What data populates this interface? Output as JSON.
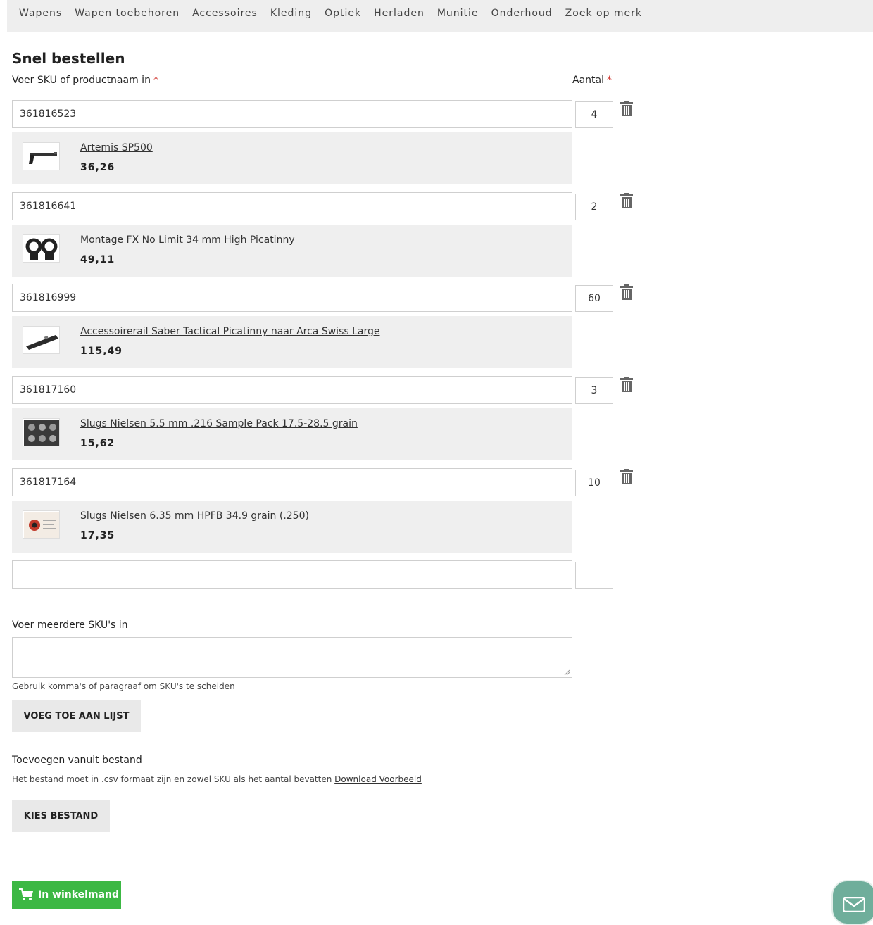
{
  "nav": {
    "items": [
      "Wapens",
      "Wapen toebehoren",
      "Accessoires",
      "Kleding",
      "Optiek",
      "Herladen",
      "Munitie",
      "Onderhoud",
      "Zoek op merk"
    ]
  },
  "page": {
    "title": "Snel bestellen"
  },
  "labels": {
    "sku": "Voer SKU of productnaam in",
    "qty": "Aantal",
    "required_mark": "*"
  },
  "rows": [
    {
      "sku": "361816523",
      "qty": "4",
      "product": {
        "name": "Artemis SP500",
        "price": "36,26",
        "thumb_icon": "air-pistol-icon"
      }
    },
    {
      "sku": "361816641",
      "qty": "2",
      "product": {
        "name": "Montage FX No Limit 34 mm High Picatinny",
        "price": "49,11",
        "thumb_icon": "scope-rings-icon"
      }
    },
    {
      "sku": "361816999",
      "qty": "60",
      "product": {
        "name": "Accessoirerail Saber Tactical Picatinny naar Arca Swiss Large",
        "price": "115,49",
        "thumb_icon": "rail-icon"
      }
    },
    {
      "sku": "361817160",
      "qty": "3",
      "product": {
        "name": "Slugs Nielsen 5.5 mm .216 Sample Pack 17.5-28.5 grain",
        "price": "15,62",
        "thumb_icon": "sample-pack-icon"
      }
    },
    {
      "sku": "361817164",
      "qty": "10",
      "product": {
        "name": "Slugs Nielsen 6.35 mm HPFB 34.9 grain (.250)",
        "price": "17,35",
        "thumb_icon": "slug-box-icon"
      }
    }
  ],
  "empty_row": {
    "sku": "",
    "qty": ""
  },
  "multi": {
    "label": "Voer meerdere SKU's in",
    "value": "",
    "hint": "Gebruik komma's of paragraaf om SKU's te scheiden",
    "button": "VOEG TOE AAN LIJST"
  },
  "file": {
    "label": "Toevoegen vanuit bestand",
    "hint": "Het bestand moet in .csv formaat zijn en zowel SKU als het aantal bevatten",
    "link": "Download Voorbeeld",
    "button": "KIES BESTAND"
  },
  "cart": {
    "button": "In winkelmand"
  },
  "colors": {
    "accent_green": "#3cb844",
    "required_red": "#d0332c",
    "chat_teal": "#6fae9b"
  }
}
